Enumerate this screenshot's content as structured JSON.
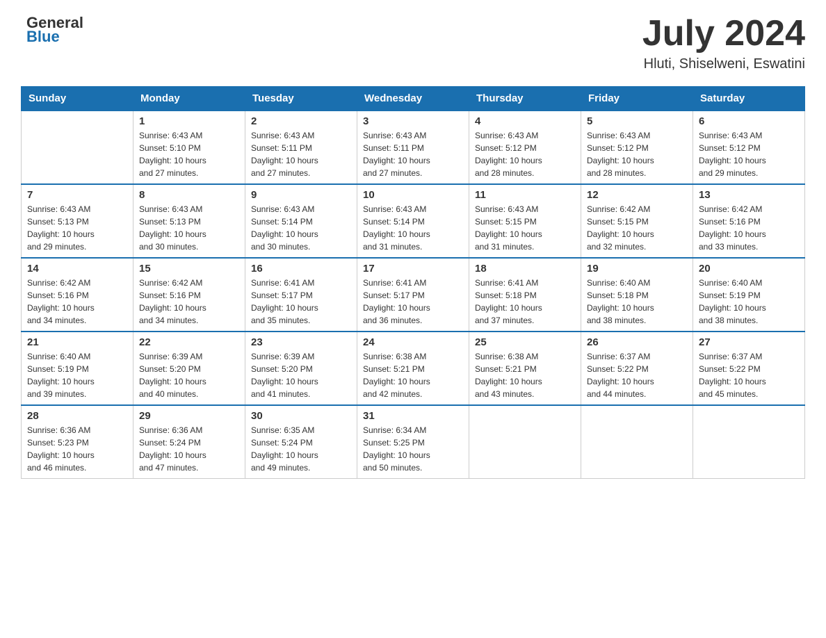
{
  "header": {
    "logo_general": "General",
    "logo_blue": "Blue",
    "title": "July 2024",
    "subtitle": "Hluti, Shiselweni, Eswatini"
  },
  "calendar": {
    "days_of_week": [
      "Sunday",
      "Monday",
      "Tuesday",
      "Wednesday",
      "Thursday",
      "Friday",
      "Saturday"
    ],
    "weeks": [
      [
        {
          "day": "",
          "info": ""
        },
        {
          "day": "1",
          "info": "Sunrise: 6:43 AM\nSunset: 5:10 PM\nDaylight: 10 hours\nand 27 minutes."
        },
        {
          "day": "2",
          "info": "Sunrise: 6:43 AM\nSunset: 5:11 PM\nDaylight: 10 hours\nand 27 minutes."
        },
        {
          "day": "3",
          "info": "Sunrise: 6:43 AM\nSunset: 5:11 PM\nDaylight: 10 hours\nand 27 minutes."
        },
        {
          "day": "4",
          "info": "Sunrise: 6:43 AM\nSunset: 5:12 PM\nDaylight: 10 hours\nand 28 minutes."
        },
        {
          "day": "5",
          "info": "Sunrise: 6:43 AM\nSunset: 5:12 PM\nDaylight: 10 hours\nand 28 minutes."
        },
        {
          "day": "6",
          "info": "Sunrise: 6:43 AM\nSunset: 5:12 PM\nDaylight: 10 hours\nand 29 minutes."
        }
      ],
      [
        {
          "day": "7",
          "info": "Sunrise: 6:43 AM\nSunset: 5:13 PM\nDaylight: 10 hours\nand 29 minutes."
        },
        {
          "day": "8",
          "info": "Sunrise: 6:43 AM\nSunset: 5:13 PM\nDaylight: 10 hours\nand 30 minutes."
        },
        {
          "day": "9",
          "info": "Sunrise: 6:43 AM\nSunset: 5:14 PM\nDaylight: 10 hours\nand 30 minutes."
        },
        {
          "day": "10",
          "info": "Sunrise: 6:43 AM\nSunset: 5:14 PM\nDaylight: 10 hours\nand 31 minutes."
        },
        {
          "day": "11",
          "info": "Sunrise: 6:43 AM\nSunset: 5:15 PM\nDaylight: 10 hours\nand 31 minutes."
        },
        {
          "day": "12",
          "info": "Sunrise: 6:42 AM\nSunset: 5:15 PM\nDaylight: 10 hours\nand 32 minutes."
        },
        {
          "day": "13",
          "info": "Sunrise: 6:42 AM\nSunset: 5:16 PM\nDaylight: 10 hours\nand 33 minutes."
        }
      ],
      [
        {
          "day": "14",
          "info": "Sunrise: 6:42 AM\nSunset: 5:16 PM\nDaylight: 10 hours\nand 34 minutes."
        },
        {
          "day": "15",
          "info": "Sunrise: 6:42 AM\nSunset: 5:16 PM\nDaylight: 10 hours\nand 34 minutes."
        },
        {
          "day": "16",
          "info": "Sunrise: 6:41 AM\nSunset: 5:17 PM\nDaylight: 10 hours\nand 35 minutes."
        },
        {
          "day": "17",
          "info": "Sunrise: 6:41 AM\nSunset: 5:17 PM\nDaylight: 10 hours\nand 36 minutes."
        },
        {
          "day": "18",
          "info": "Sunrise: 6:41 AM\nSunset: 5:18 PM\nDaylight: 10 hours\nand 37 minutes."
        },
        {
          "day": "19",
          "info": "Sunrise: 6:40 AM\nSunset: 5:18 PM\nDaylight: 10 hours\nand 38 minutes."
        },
        {
          "day": "20",
          "info": "Sunrise: 6:40 AM\nSunset: 5:19 PM\nDaylight: 10 hours\nand 38 minutes."
        }
      ],
      [
        {
          "day": "21",
          "info": "Sunrise: 6:40 AM\nSunset: 5:19 PM\nDaylight: 10 hours\nand 39 minutes."
        },
        {
          "day": "22",
          "info": "Sunrise: 6:39 AM\nSunset: 5:20 PM\nDaylight: 10 hours\nand 40 minutes."
        },
        {
          "day": "23",
          "info": "Sunrise: 6:39 AM\nSunset: 5:20 PM\nDaylight: 10 hours\nand 41 minutes."
        },
        {
          "day": "24",
          "info": "Sunrise: 6:38 AM\nSunset: 5:21 PM\nDaylight: 10 hours\nand 42 minutes."
        },
        {
          "day": "25",
          "info": "Sunrise: 6:38 AM\nSunset: 5:21 PM\nDaylight: 10 hours\nand 43 minutes."
        },
        {
          "day": "26",
          "info": "Sunrise: 6:37 AM\nSunset: 5:22 PM\nDaylight: 10 hours\nand 44 minutes."
        },
        {
          "day": "27",
          "info": "Sunrise: 6:37 AM\nSunset: 5:22 PM\nDaylight: 10 hours\nand 45 minutes."
        }
      ],
      [
        {
          "day": "28",
          "info": "Sunrise: 6:36 AM\nSunset: 5:23 PM\nDaylight: 10 hours\nand 46 minutes."
        },
        {
          "day": "29",
          "info": "Sunrise: 6:36 AM\nSunset: 5:24 PM\nDaylight: 10 hours\nand 47 minutes."
        },
        {
          "day": "30",
          "info": "Sunrise: 6:35 AM\nSunset: 5:24 PM\nDaylight: 10 hours\nand 49 minutes."
        },
        {
          "day": "31",
          "info": "Sunrise: 6:34 AM\nSunset: 5:25 PM\nDaylight: 10 hours\nand 50 minutes."
        },
        {
          "day": "",
          "info": ""
        },
        {
          "day": "",
          "info": ""
        },
        {
          "day": "",
          "info": ""
        }
      ]
    ]
  }
}
